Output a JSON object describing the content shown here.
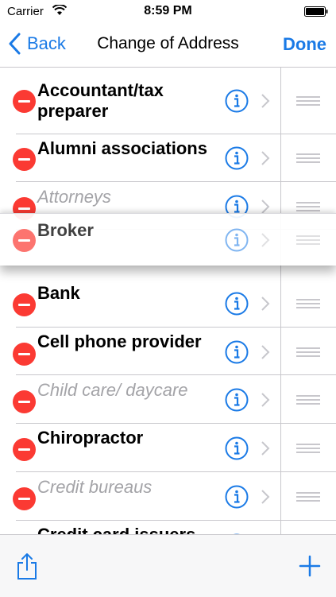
{
  "status_bar": {
    "carrier": "Carrier",
    "time": "8:59 PM",
    "wifi_icon": "wifi-icon",
    "battery_icon": "battery-icon"
  },
  "nav": {
    "back_label": "Back",
    "title": "Change of Address",
    "done_label": "Done"
  },
  "colors": {
    "accent": "#1a7ae6",
    "delete": "#fb3a33",
    "inactive_text": "#a4a4a8",
    "separator": "#c8c7cc"
  },
  "rows": [
    {
      "label": "Accountant/tax preparer",
      "active": true
    },
    {
      "label": "Alumni associations",
      "active": true
    },
    {
      "label": "Attorneys",
      "active": false
    },
    {
      "label": "Bank",
      "active": true
    },
    {
      "label": "Cell phone provider",
      "active": true
    },
    {
      "label": "Child care/ daycare",
      "active": false
    },
    {
      "label": "Chiropractor",
      "active": true
    },
    {
      "label": "Credit bureaus",
      "active": false
    },
    {
      "label": "Credit card issuers",
      "active": true
    }
  ],
  "dragging_row": {
    "label": "Broker",
    "active": true
  },
  "toolbar": {
    "share_icon": "share-icon",
    "add_icon": "plus-icon"
  }
}
